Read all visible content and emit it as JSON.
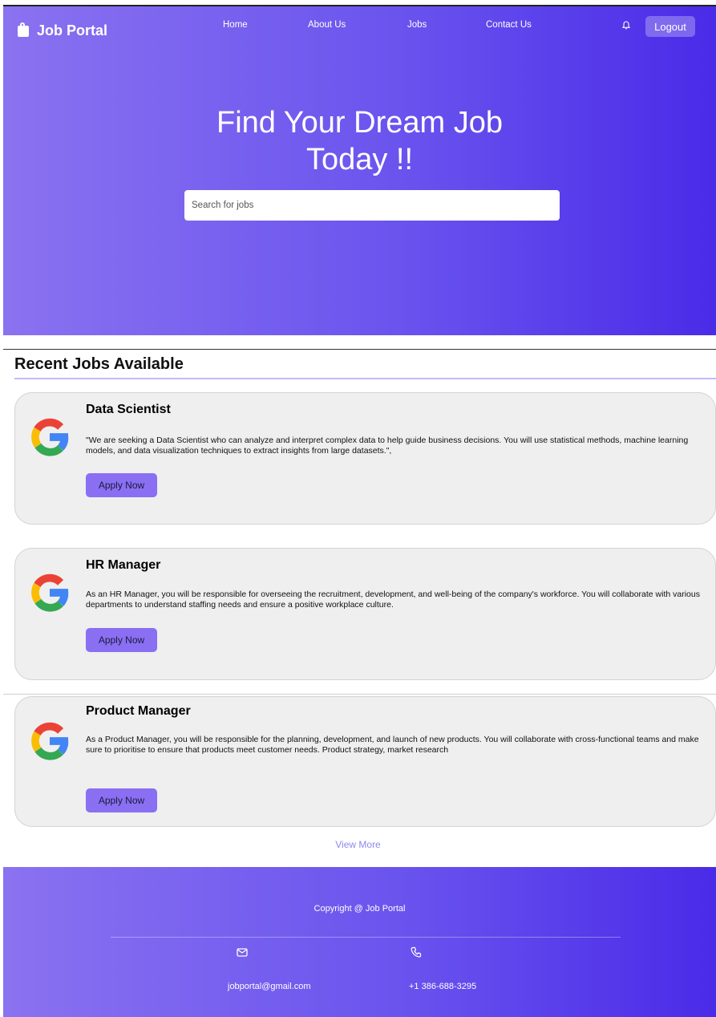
{
  "header": {
    "brand": "Job Portal",
    "brand_icon": "bag-icon",
    "nav": [
      "Home",
      "About Us",
      "Jobs",
      "Contact Us"
    ],
    "notification_icon": "bell-icon",
    "logout_label": "Logout"
  },
  "hero": {
    "title": "Find Your Dream Job Today !!",
    "search_placeholder": "Search for jobs"
  },
  "jobs_section": {
    "title": "Recent Jobs Available",
    "jobs": [
      {
        "logo": "google-logo-icon",
        "title": "Data Scientist",
        "description": "\"We are seeking a Data Scientist who can analyze and interpret complex data to help guide business decisions. You will use statistical methods, machine learning models, and data visualization techniques to extract insights from large datasets.\",",
        "apply_label": "Apply Now"
      },
      {
        "logo": "google-logo-icon",
        "title": "HR Manager",
        "description": "As an HR Manager, you will be responsible for overseeing the recruitment, development, and well-being of the company's workforce. You will collaborate with various departments to understand staffing needs and ensure a positive workplace culture.",
        "apply_label": "Apply Now"
      },
      {
        "logo": "google-logo-icon",
        "title": "Product Manager",
        "description": "As a Product Manager, you will be responsible for the planning, development, and launch of new products. You will collaborate with cross-functional teams and make sure to prioritise to ensure that products meet customer needs. Product strategy, market research",
        "apply_label": "Apply Now"
      }
    ],
    "view_more": "View More"
  },
  "footer": {
    "copyright": "Copyright @ Job Portal",
    "email_icon": "mail-icon",
    "email": "jobportal@gmail.com",
    "phone_icon": "phone-icon",
    "phone": "+1 386-688-3295"
  },
  "colors": {
    "gradient_start": "#8a72f0",
    "gradient_end": "#4a2be8",
    "button_accent": "#8a6ff3",
    "link": "#8f86f0"
  }
}
